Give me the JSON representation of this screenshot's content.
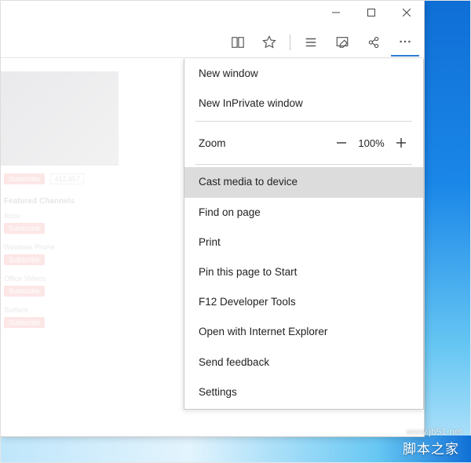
{
  "window_controls": {
    "minimize": "minimize",
    "maximize": "maximize",
    "close": "close"
  },
  "toolbar_icons": {
    "reading_view": "reading-view",
    "favorite": "favorite",
    "hub": "hub",
    "web_note": "web-note",
    "share": "share",
    "more": "more"
  },
  "menu": {
    "new_window": "New window",
    "new_inprivate": "New InPrivate window",
    "zoom_label": "Zoom",
    "zoom_value": "100%",
    "cast": "Cast media to device",
    "find": "Find on page",
    "print": "Print",
    "pin": "Pin this page to Start",
    "f12": "F12 Developer Tools",
    "open_ie": "Open with Internet Explorer",
    "feedback": "Send feedback",
    "settings": "Settings"
  },
  "page": {
    "subscribe_label": "Subscribe",
    "subscriber_count": "412,657",
    "section_title": "Featured Channels",
    "channels": [
      "Xbox",
      "Windows Phone",
      "Office Videos",
      "Surface"
    ]
  },
  "watermark": "www.jb51.net",
  "caption": "脚本之家"
}
